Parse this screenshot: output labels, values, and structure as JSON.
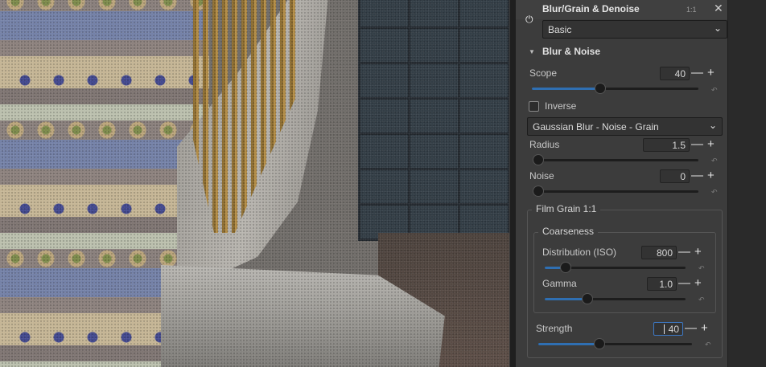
{
  "header": {
    "title": "Blur/Grain & Denoise",
    "one_to_one": "1:1",
    "close_symbol": "✕",
    "power_symbol": "⏻"
  },
  "preset": {
    "value": "Basic"
  },
  "blur_noise": {
    "title": "Blur & Noise",
    "scope": {
      "label": "Scope",
      "value": "40",
      "level": 0.41
    },
    "inverse": {
      "label": "Inverse",
      "checked": false
    },
    "method": {
      "value": "Gaussian Blur - Noise - Grain"
    },
    "radius": {
      "label": "Radius",
      "value": "1.5",
      "level": 0.0
    },
    "noise": {
      "label": "Noise",
      "value": "0",
      "level": 0.0
    }
  },
  "film_grain": {
    "title": "Film Grain 1:1",
    "coarseness": {
      "title": "Coarseness",
      "distribution": {
        "label": "Distribution (ISO)",
        "value": "800",
        "level": 0.15
      },
      "gamma": {
        "label": "Gamma",
        "value": "1.0",
        "level": 0.3
      }
    },
    "strength": {
      "label": "Strength",
      "value": "40",
      "level": 0.4
    }
  },
  "symbols": {
    "minus": "—",
    "plus": "+",
    "chevron": "⌄",
    "triangle": "▼",
    "reset": "↶"
  },
  "colors": {
    "accent": "#2f6fb2",
    "panel": "#3c3c3c"
  }
}
